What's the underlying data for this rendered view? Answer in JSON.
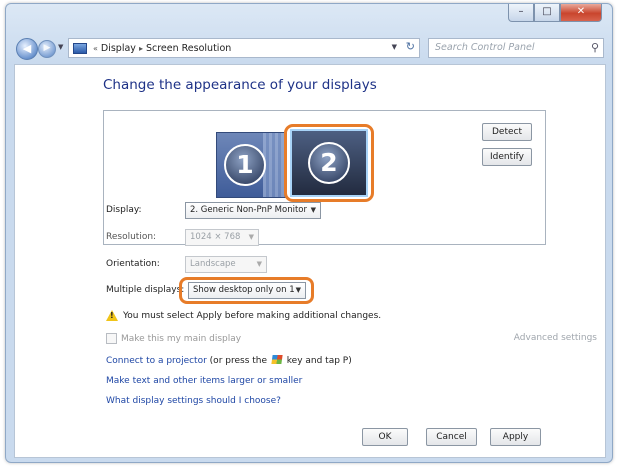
{
  "window": {
    "minimize": "–",
    "maximize": "□",
    "close": "✕"
  },
  "address": {
    "crumb_sep": "«",
    "crumbs": [
      "Display",
      "Screen Resolution"
    ],
    "arrow": "▸",
    "search_placeholder": "Search Control Panel"
  },
  "heading": "Change the appearance of your displays",
  "monitors": [
    {
      "number": "1"
    },
    {
      "number": "2",
      "selected": true
    }
  ],
  "buttons": {
    "detect": "Detect",
    "identify": "Identify",
    "ok": "OK",
    "cancel": "Cancel",
    "apply": "Apply"
  },
  "fields": {
    "display_label": "Display:",
    "display_value": "2. Generic Non-PnP Monitor",
    "resolution_label": "Resolution:",
    "resolution_value": "1024 × 768",
    "orientation_label": "Orientation:",
    "orientation_value": "Landscape",
    "multiple_label": "Multiple displays:",
    "multiple_value": "Show desktop only on 1"
  },
  "warning": "You must select Apply before making additional changes.",
  "main_display_checkbox": "Make this my main display",
  "advanced_settings": "Advanced settings",
  "links": {
    "projector_link": "Connect to a projector",
    "projector_rest_1": "(or press the",
    "projector_rest_2": "key and tap P)",
    "text_size": "Make text and other items larger or smaller",
    "which_settings": "What display settings should I choose?"
  },
  "colors": {
    "highlight": "#e77c29",
    "heading": "#1e3287",
    "link": "#1f47a5"
  }
}
